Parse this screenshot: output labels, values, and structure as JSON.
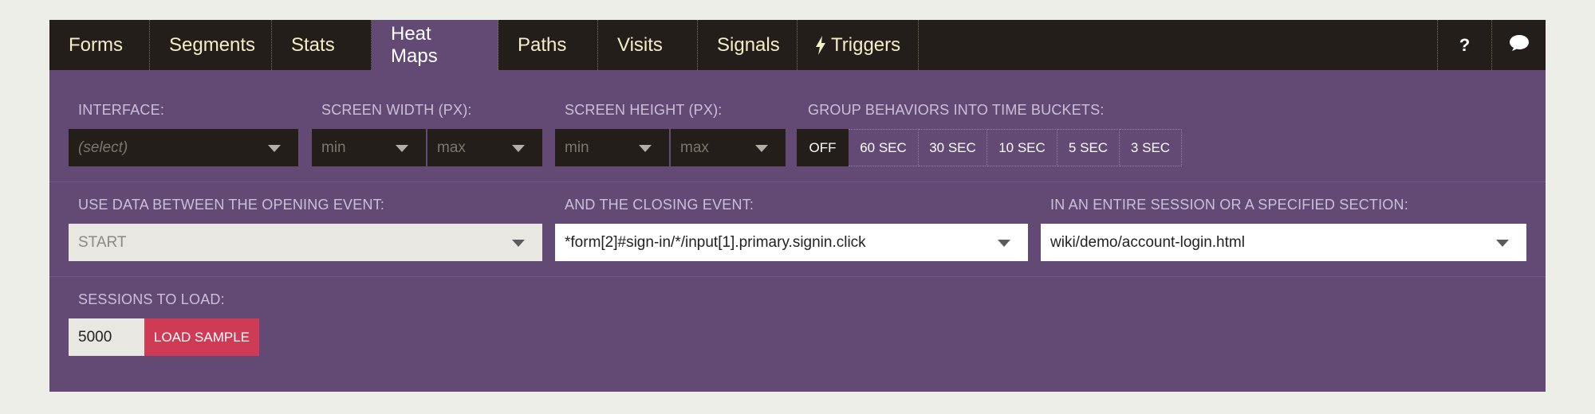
{
  "nav": {
    "tabs": [
      {
        "label": "Forms"
      },
      {
        "label": "Segments"
      },
      {
        "label": "Stats"
      },
      {
        "label": "Heat Maps"
      },
      {
        "label": "Paths"
      },
      {
        "label": "Visits"
      },
      {
        "label": "Signals"
      },
      {
        "label": "Triggers"
      }
    ],
    "active_tab": "Heat Maps",
    "help_label": "?",
    "icons": [
      "bolt-icon",
      "help-icon",
      "chat-bubble-icon"
    ]
  },
  "filters": {
    "interface": {
      "label": "INTERFACE:",
      "value": "(select)"
    },
    "screen_width": {
      "label": "SCREEN WIDTH (PX):",
      "min": "min",
      "max": "max"
    },
    "screen_height": {
      "label": "SCREEN HEIGHT (PX):",
      "min": "min",
      "max": "max"
    },
    "buckets": {
      "label": "GROUP BEHAVIORS INTO TIME BUCKETS:",
      "options": [
        "OFF",
        "60 SEC",
        "30 SEC",
        "10 SEC",
        "5 SEC",
        "3 SEC"
      ],
      "selected": "OFF"
    }
  },
  "events": {
    "opening": {
      "label": "USE DATA BETWEEN THE OPENING EVENT:",
      "value": "START"
    },
    "closing": {
      "label": "AND THE CLOSING EVENT:",
      "value": "*form[2]#sign-in/*/input[1].primary.signin.click"
    },
    "section": {
      "label": "IN AN ENTIRE SESSION OR A SPECIFIED SECTION:",
      "value": "wiki/demo/account-login.html"
    }
  },
  "sessions": {
    "label": "SESSIONS TO LOAD:",
    "value": "5000",
    "button": "LOAD SAMPLE"
  },
  "colors": {
    "nav_bg": "#231e19",
    "panel_bg": "#634a74",
    "accent": "#cf3a55",
    "nav_text": "#f2eec8"
  }
}
